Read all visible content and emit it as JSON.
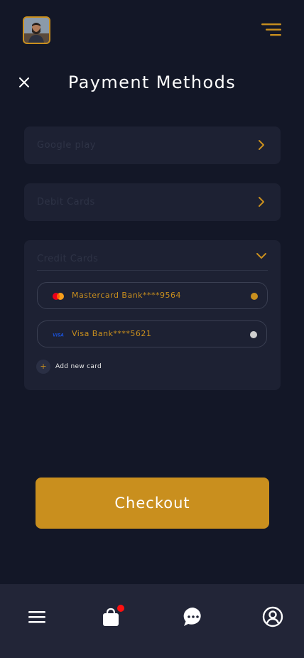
{
  "header": {
    "avatar_icon": "user-avatar",
    "menu_icon": "menu-lines-icon"
  },
  "title_bar": {
    "close_icon": "close-icon",
    "title": "Payment Methods"
  },
  "payment_sections": {
    "google_play": {
      "label": "Google play",
      "icon": "chevron-right-icon"
    },
    "debit_cards": {
      "label": "Debit Cards",
      "icon": "chevron-right-icon"
    },
    "credit_cards": {
      "label": "Credit Cards",
      "icon": "chevron-down-icon",
      "items": [
        {
          "name": "Mastercard Bank****9564",
          "logo": "mastercard-logo",
          "selected": true
        },
        {
          "name": "Visa Bank****5621",
          "logo": "visa-logo",
          "selected": false
        }
      ],
      "add_new_label": "Add new card",
      "add_icon": "plus-icon"
    }
  },
  "checkout": {
    "label": "Checkout"
  },
  "bottom_nav": {
    "items": [
      "menu-icon",
      "shopping-bag-icon",
      "chat-icon",
      "profile-icon"
    ]
  },
  "colors": {
    "background": "#131727",
    "card": "#1d2133",
    "accent": "#c98f1e",
    "nav": "#222537",
    "badge": "#ff1010"
  }
}
